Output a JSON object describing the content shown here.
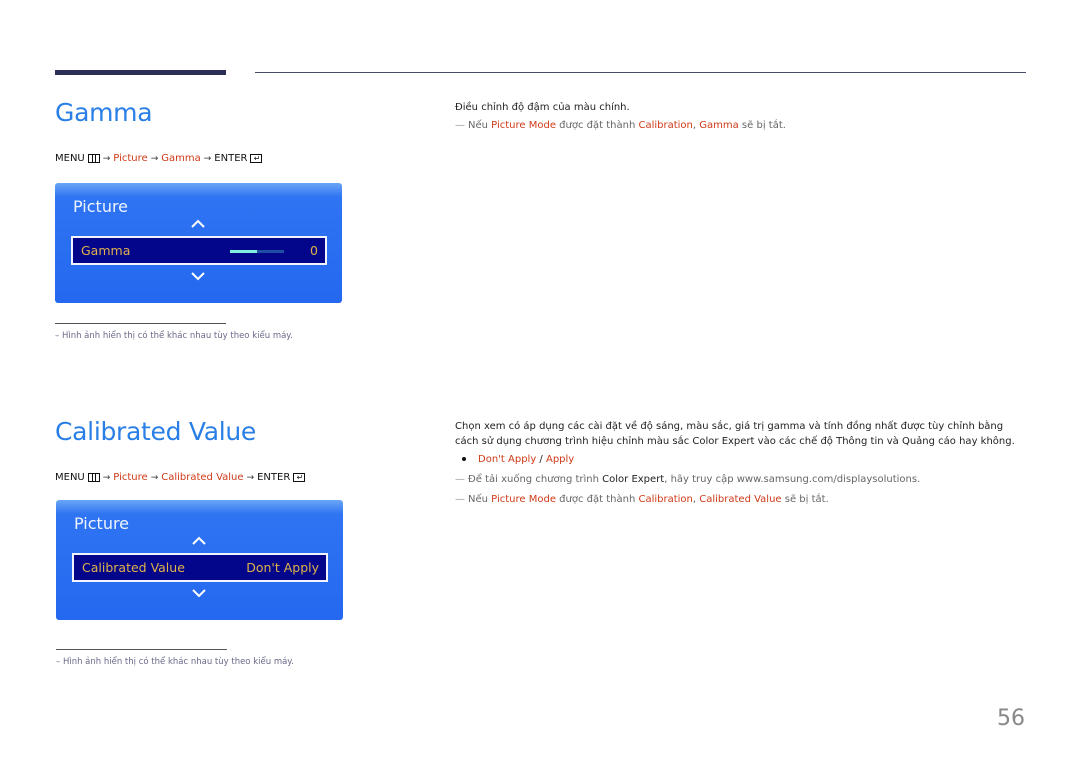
{
  "page_number": "56",
  "gamma_section": {
    "title": "Gamma",
    "path": {
      "menu": "MENU",
      "arrow": "→",
      "items": [
        "Picture",
        "Gamma"
      ],
      "enter": "ENTER",
      "enter_glyph": "↵"
    },
    "osd": {
      "title": "Picture",
      "row_label": "Gamma",
      "row_value": "0",
      "slider_fraction": 0.5
    },
    "footnote": "–  Hình ảnh hiển thị có thể khác nhau tùy theo kiểu máy.",
    "description": "Điều chỉnh độ đậm của màu chính.",
    "note": {
      "dash": "—",
      "p1": "Nếu ",
      "picture_mode": "Picture Mode",
      "p2": " được đặt thành ",
      "calibration": "Calibration",
      "comma": ", ",
      "gamma": "Gamma",
      "p3": " sẽ bị tắt."
    }
  },
  "calibrated_section": {
    "title": "Calibrated Value",
    "path": {
      "menu": "MENU",
      "arrow": "→",
      "items": [
        "Picture",
        "Calibrated Value"
      ],
      "enter": "ENTER",
      "enter_glyph": "↵"
    },
    "osd": {
      "title": "Picture",
      "row_label": "Calibrated Value",
      "row_value": "Don't Apply"
    },
    "footnote": "–  Hình ảnh hiển thị có thể khác nhau tùy theo kiểu máy.",
    "description": {
      "p1": "Chọn xem có áp dụng các cài đặt về độ sáng, màu sắc, giá trị gamma và tính đồng nhất được tùy chỉnh bằng cách sử dụng chương trình hiệu chỉnh màu sắc ",
      "color_expert": "Color Expert",
      "p2": " vào các chế độ Thông tin và Quảng cáo hay không."
    },
    "options": {
      "opt1": "Don't Apply",
      "sep": " / ",
      "opt2": "Apply"
    },
    "note1": {
      "dash": "—",
      "p1": "Để tải xuống chương trình ",
      "color_expert": "Color Expert",
      "p2": ", hãy truy cập www.samsung.com/displaysolutions."
    },
    "note2": {
      "dash": "—",
      "p1": "Nếu ",
      "picture_mode": "Picture Mode",
      "p2": " được đặt thành ",
      "calibration": "Calibration",
      "comma": ", ",
      "calibrated_value": "Calibrated Value",
      "p3": " sẽ bị tắt."
    }
  },
  "colors": {
    "heading": "#2a7fe6",
    "highlight": "#d03a18",
    "osd_blue": "#2468f0",
    "osd_row": "#03068a",
    "osd_text": "#e2b24a"
  }
}
